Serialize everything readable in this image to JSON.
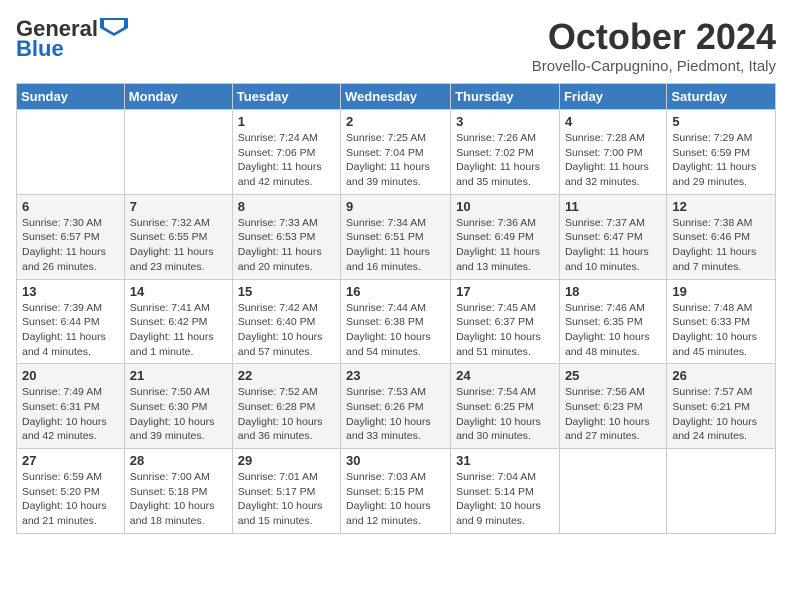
{
  "header": {
    "logo_general": "General",
    "logo_blue": "Blue",
    "month": "October 2024",
    "location": "Brovello-Carpugnino, Piedmont, Italy"
  },
  "days_of_week": [
    "Sunday",
    "Monday",
    "Tuesday",
    "Wednesday",
    "Thursday",
    "Friday",
    "Saturday"
  ],
  "weeks": [
    [
      {
        "num": "",
        "info": ""
      },
      {
        "num": "",
        "info": ""
      },
      {
        "num": "1",
        "info": "Sunrise: 7:24 AM\nSunset: 7:06 PM\nDaylight: 11 hours and 42 minutes."
      },
      {
        "num": "2",
        "info": "Sunrise: 7:25 AM\nSunset: 7:04 PM\nDaylight: 11 hours and 39 minutes."
      },
      {
        "num": "3",
        "info": "Sunrise: 7:26 AM\nSunset: 7:02 PM\nDaylight: 11 hours and 35 minutes."
      },
      {
        "num": "4",
        "info": "Sunrise: 7:28 AM\nSunset: 7:00 PM\nDaylight: 11 hours and 32 minutes."
      },
      {
        "num": "5",
        "info": "Sunrise: 7:29 AM\nSunset: 6:59 PM\nDaylight: 11 hours and 29 minutes."
      }
    ],
    [
      {
        "num": "6",
        "info": "Sunrise: 7:30 AM\nSunset: 6:57 PM\nDaylight: 11 hours and 26 minutes."
      },
      {
        "num": "7",
        "info": "Sunrise: 7:32 AM\nSunset: 6:55 PM\nDaylight: 11 hours and 23 minutes."
      },
      {
        "num": "8",
        "info": "Sunrise: 7:33 AM\nSunset: 6:53 PM\nDaylight: 11 hours and 20 minutes."
      },
      {
        "num": "9",
        "info": "Sunrise: 7:34 AM\nSunset: 6:51 PM\nDaylight: 11 hours and 16 minutes."
      },
      {
        "num": "10",
        "info": "Sunrise: 7:36 AM\nSunset: 6:49 PM\nDaylight: 11 hours and 13 minutes."
      },
      {
        "num": "11",
        "info": "Sunrise: 7:37 AM\nSunset: 6:47 PM\nDaylight: 11 hours and 10 minutes."
      },
      {
        "num": "12",
        "info": "Sunrise: 7:38 AM\nSunset: 6:46 PM\nDaylight: 11 hours and 7 minutes."
      }
    ],
    [
      {
        "num": "13",
        "info": "Sunrise: 7:39 AM\nSunset: 6:44 PM\nDaylight: 11 hours and 4 minutes."
      },
      {
        "num": "14",
        "info": "Sunrise: 7:41 AM\nSunset: 6:42 PM\nDaylight: 11 hours and 1 minute."
      },
      {
        "num": "15",
        "info": "Sunrise: 7:42 AM\nSunset: 6:40 PM\nDaylight: 10 hours and 57 minutes."
      },
      {
        "num": "16",
        "info": "Sunrise: 7:44 AM\nSunset: 6:38 PM\nDaylight: 10 hours and 54 minutes."
      },
      {
        "num": "17",
        "info": "Sunrise: 7:45 AM\nSunset: 6:37 PM\nDaylight: 10 hours and 51 minutes."
      },
      {
        "num": "18",
        "info": "Sunrise: 7:46 AM\nSunset: 6:35 PM\nDaylight: 10 hours and 48 minutes."
      },
      {
        "num": "19",
        "info": "Sunrise: 7:48 AM\nSunset: 6:33 PM\nDaylight: 10 hours and 45 minutes."
      }
    ],
    [
      {
        "num": "20",
        "info": "Sunrise: 7:49 AM\nSunset: 6:31 PM\nDaylight: 10 hours and 42 minutes."
      },
      {
        "num": "21",
        "info": "Sunrise: 7:50 AM\nSunset: 6:30 PM\nDaylight: 10 hours and 39 minutes."
      },
      {
        "num": "22",
        "info": "Sunrise: 7:52 AM\nSunset: 6:28 PM\nDaylight: 10 hours and 36 minutes."
      },
      {
        "num": "23",
        "info": "Sunrise: 7:53 AM\nSunset: 6:26 PM\nDaylight: 10 hours and 33 minutes."
      },
      {
        "num": "24",
        "info": "Sunrise: 7:54 AM\nSunset: 6:25 PM\nDaylight: 10 hours and 30 minutes."
      },
      {
        "num": "25",
        "info": "Sunrise: 7:56 AM\nSunset: 6:23 PM\nDaylight: 10 hours and 27 minutes."
      },
      {
        "num": "26",
        "info": "Sunrise: 7:57 AM\nSunset: 6:21 PM\nDaylight: 10 hours and 24 minutes."
      }
    ],
    [
      {
        "num": "27",
        "info": "Sunrise: 6:59 AM\nSunset: 5:20 PM\nDaylight: 10 hours and 21 minutes."
      },
      {
        "num": "28",
        "info": "Sunrise: 7:00 AM\nSunset: 5:18 PM\nDaylight: 10 hours and 18 minutes."
      },
      {
        "num": "29",
        "info": "Sunrise: 7:01 AM\nSunset: 5:17 PM\nDaylight: 10 hours and 15 minutes."
      },
      {
        "num": "30",
        "info": "Sunrise: 7:03 AM\nSunset: 5:15 PM\nDaylight: 10 hours and 12 minutes."
      },
      {
        "num": "31",
        "info": "Sunrise: 7:04 AM\nSunset: 5:14 PM\nDaylight: 10 hours and 9 minutes."
      },
      {
        "num": "",
        "info": ""
      },
      {
        "num": "",
        "info": ""
      }
    ]
  ]
}
